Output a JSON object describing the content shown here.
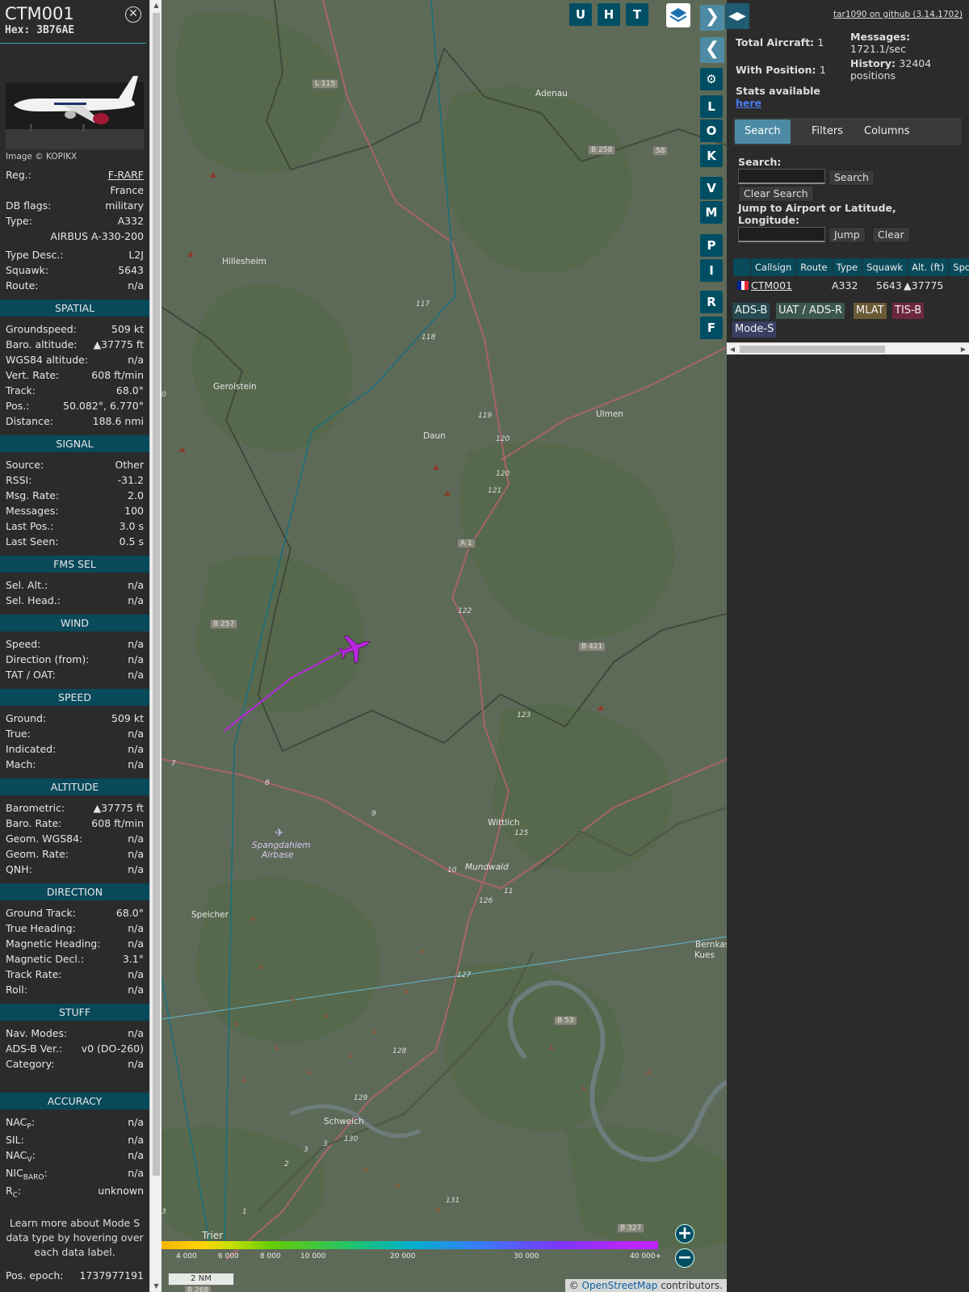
{
  "aircraft": {
    "callsign": "CTM001",
    "hex_label": "Hex:",
    "hex": "3B76AE",
    "image_credit": "Image © KOPIKX"
  },
  "details": {
    "reg_label": "Reg.:",
    "reg": "F-RARF",
    "country": "France",
    "dbflags_label": "DB flags:",
    "dbflags": "military",
    "type_label": "Type:",
    "type": "A332",
    "type_full": "AIRBUS A-330-200",
    "typedesc_label": "Type Desc.:",
    "typedesc": "L2J",
    "squawk_label": "Squawk:",
    "squawk": "5643",
    "route_label": "Route:",
    "route": "n/a"
  },
  "sections": {
    "spatial": "SPATIAL",
    "signal": "SIGNAL",
    "fms": "FMS SEL",
    "wind": "WIND",
    "speed": "SPEED",
    "altitude": "ALTITUDE",
    "direction": "DIRECTION",
    "stuff": "STUFF",
    "accuracy": "ACCURACY"
  },
  "spatial": [
    {
      "label": "Groundspeed:",
      "value": "509 kt"
    },
    {
      "label": "Baro. altitude:",
      "value": "▲37775 ft"
    },
    {
      "label": "WGS84 altitude:",
      "value": "n/a"
    },
    {
      "label": "Vert. Rate:",
      "value": "608 ft/min"
    },
    {
      "label": "Track:",
      "value": "68.0°"
    },
    {
      "label": "Pos.:",
      "value": "50.082°, 6.770°"
    },
    {
      "label": "Distance:",
      "value": "188.6 nmi"
    }
  ],
  "signal": [
    {
      "label": "Source:",
      "value": "Other"
    },
    {
      "label": "RSSI:",
      "value": "-31.2"
    },
    {
      "label": "Msg. Rate:",
      "value": "2.0"
    },
    {
      "label": "Messages:",
      "value": "100"
    },
    {
      "label": "Last Pos.:",
      "value": "3.0 s"
    },
    {
      "label": "Last Seen:",
      "value": "0.5 s"
    }
  ],
  "fms": [
    {
      "label": "Sel. Alt.:",
      "value": "n/a"
    },
    {
      "label": "Sel. Head.:",
      "value": "n/a"
    }
  ],
  "wind": [
    {
      "label": "Speed:",
      "value": "n/a"
    },
    {
      "label": "Direction (from):",
      "value": "n/a"
    },
    {
      "label": "TAT / OAT:",
      "value": "n/a"
    }
  ],
  "speed": [
    {
      "label": "Ground:",
      "value": "509 kt"
    },
    {
      "label": "True:",
      "value": "n/a"
    },
    {
      "label": "Indicated:",
      "value": "n/a"
    },
    {
      "label": "Mach:",
      "value": "n/a"
    }
  ],
  "altitude": [
    {
      "label": "Barometric:",
      "value": "▲37775 ft"
    },
    {
      "label": "Baro. Rate:",
      "value": "608 ft/min"
    },
    {
      "label": "Geom. WGS84:",
      "value": "n/a"
    },
    {
      "label": "Geom. Rate:",
      "value": "n/a"
    },
    {
      "label": "QNH:",
      "value": "n/a"
    }
  ],
  "direction": [
    {
      "label": "Ground Track:",
      "value": "68.0°"
    },
    {
      "label": "True Heading:",
      "value": "n/a"
    },
    {
      "label": "Magnetic Heading:",
      "value": "n/a"
    },
    {
      "label": "Magnetic Decl.:",
      "value": "3.1°"
    },
    {
      "label": "Track Rate:",
      "value": "n/a"
    },
    {
      "label": "Roll:",
      "value": "n/a"
    }
  ],
  "stuff": [
    {
      "label": "Nav. Modes:",
      "value": "n/a"
    },
    {
      "label": "ADS-B Ver.:",
      "value": "v0 (DO-260)"
    },
    {
      "label": "Category:",
      "value": "n/a"
    }
  ],
  "accuracy": {
    "nacp": {
      "base": "NAC",
      "sub": "P",
      "value": "n/a"
    },
    "sil": {
      "label": "SIL:",
      "value": "n/a"
    },
    "nacv": {
      "base": "NAC",
      "sub": "V",
      "value": "n/a"
    },
    "nicbaro": {
      "base": "NIC",
      "sub": "BARO",
      "value": "n/a"
    },
    "rc": {
      "base": "R",
      "sub": "C",
      "value": "unknown"
    }
  },
  "note": "Learn more about Mode S data type by hovering over each data label.",
  "pos_epoch": {
    "label": "Pos. epoch:",
    "value": "1737977191"
  },
  "map": {
    "places": [
      "Adenau",
      "Hillesheim",
      "Gerolstein",
      "Daun",
      "Ulmen",
      "Wittlich",
      "Speicher",
      "Spangdahlem",
      "Airbase",
      "Schweich",
      "Trier",
      "Bernkas",
      "Kues",
      "Mundwald"
    ],
    "roads": [
      "L 115",
      "B 258",
      "A 1",
      "B 257",
      "B 421",
      "B 53",
      "B 327",
      "B 268",
      "58"
    ],
    "numbers": [
      "117",
      "118",
      "119",
      "120",
      "121",
      "120",
      "122",
      "123",
      "125",
      "126",
      "127",
      "128",
      "129",
      "130",
      "131",
      "8",
      "9",
      "10",
      "11",
      "3",
      "2",
      "1",
      "3",
      "3",
      "7",
      "0"
    ],
    "colorbar": [
      "4 000",
      "6 000",
      "8 000",
      "10 000",
      "20 000",
      "30 000",
      "40 000+"
    ],
    "scale": "2 NM",
    "attribution_prefix": "© ",
    "attribution_link": "OpenStreetMap",
    "attribution_suffix": " contributors.",
    "buttons": [
      "U",
      "H",
      "T"
    ],
    "side_buttons": [
      "L",
      "O",
      "K",
      "V",
      "M",
      "P",
      "I",
      "R",
      "F"
    ],
    "zoom_in": "+",
    "zoom_out": "−",
    "aircraft_icon": "airplane-icon",
    "track_color": "#b927e0"
  },
  "stats": {
    "version": "tar1090 on github (3.14.1702)",
    "total_label": "Total Aircraft:",
    "total": "1",
    "withpos_label": "With Position:",
    "withpos": "1",
    "messages_label": "Messages:",
    "messages": "1721.1/sec",
    "history_label": "History:",
    "history": "32404 positions",
    "stats_label": "Stats available",
    "stats_link": "here"
  },
  "tabs": [
    "Search",
    "Filters",
    "Columns"
  ],
  "search": {
    "label": "Search:",
    "search_btn": "Search",
    "clear_btn": "Clear Search",
    "jump_label": "Jump to Airport or Latitude, Longitude:",
    "jump_btn": "Jump",
    "clear2_btn": "Clear"
  },
  "table": {
    "headers": [
      "",
      "Callsign",
      "Route",
      "Type",
      "Squawk",
      "Alt. (ft)",
      "Spd"
    ],
    "row": {
      "callsign": "CTM001",
      "route": "",
      "type": "A332",
      "squawk": "5643",
      "alt": "▲37775"
    }
  },
  "sources": [
    "ADS-B",
    "UAT / ADS-R",
    "MLAT",
    "TIS-B",
    "Mode-S"
  ],
  "colors": {
    "accent": "#08495a",
    "button": "#4d8ba5",
    "map": "#5f6b59",
    "adsb": "#264a52",
    "uat": "#3c5650",
    "mlat": "#6a5a36",
    "tisb": "#6c2840",
    "modes": "#3a4063"
  }
}
